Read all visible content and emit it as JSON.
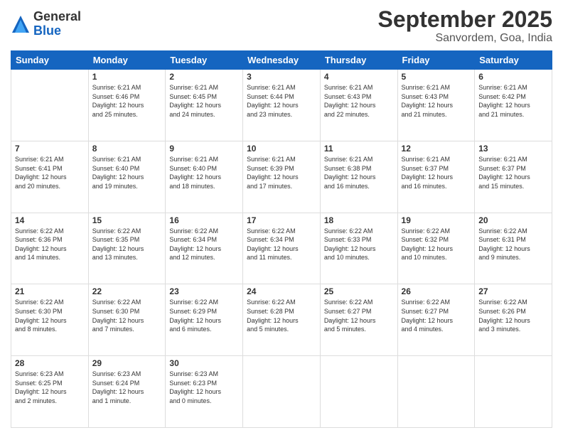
{
  "logo": {
    "general": "General",
    "blue": "Blue"
  },
  "title": "September 2025",
  "subtitle": "Sanvordem, Goa, India",
  "days_header": [
    "Sunday",
    "Monday",
    "Tuesday",
    "Wednesday",
    "Thursday",
    "Friday",
    "Saturday"
  ],
  "weeks": [
    [
      {
        "num": "",
        "info": ""
      },
      {
        "num": "1",
        "info": "Sunrise: 6:21 AM\nSunset: 6:46 PM\nDaylight: 12 hours\nand 25 minutes."
      },
      {
        "num": "2",
        "info": "Sunrise: 6:21 AM\nSunset: 6:45 PM\nDaylight: 12 hours\nand 24 minutes."
      },
      {
        "num": "3",
        "info": "Sunrise: 6:21 AM\nSunset: 6:44 PM\nDaylight: 12 hours\nand 23 minutes."
      },
      {
        "num": "4",
        "info": "Sunrise: 6:21 AM\nSunset: 6:43 PM\nDaylight: 12 hours\nand 22 minutes."
      },
      {
        "num": "5",
        "info": "Sunrise: 6:21 AM\nSunset: 6:43 PM\nDaylight: 12 hours\nand 21 minutes."
      },
      {
        "num": "6",
        "info": "Sunrise: 6:21 AM\nSunset: 6:42 PM\nDaylight: 12 hours\nand 21 minutes."
      }
    ],
    [
      {
        "num": "7",
        "info": "Sunrise: 6:21 AM\nSunset: 6:41 PM\nDaylight: 12 hours\nand 20 minutes."
      },
      {
        "num": "8",
        "info": "Sunrise: 6:21 AM\nSunset: 6:40 PM\nDaylight: 12 hours\nand 19 minutes."
      },
      {
        "num": "9",
        "info": "Sunrise: 6:21 AM\nSunset: 6:40 PM\nDaylight: 12 hours\nand 18 minutes."
      },
      {
        "num": "10",
        "info": "Sunrise: 6:21 AM\nSunset: 6:39 PM\nDaylight: 12 hours\nand 17 minutes."
      },
      {
        "num": "11",
        "info": "Sunrise: 6:21 AM\nSunset: 6:38 PM\nDaylight: 12 hours\nand 16 minutes."
      },
      {
        "num": "12",
        "info": "Sunrise: 6:21 AM\nSunset: 6:37 PM\nDaylight: 12 hours\nand 16 minutes."
      },
      {
        "num": "13",
        "info": "Sunrise: 6:21 AM\nSunset: 6:37 PM\nDaylight: 12 hours\nand 15 minutes."
      }
    ],
    [
      {
        "num": "14",
        "info": "Sunrise: 6:22 AM\nSunset: 6:36 PM\nDaylight: 12 hours\nand 14 minutes."
      },
      {
        "num": "15",
        "info": "Sunrise: 6:22 AM\nSunset: 6:35 PM\nDaylight: 12 hours\nand 13 minutes."
      },
      {
        "num": "16",
        "info": "Sunrise: 6:22 AM\nSunset: 6:34 PM\nDaylight: 12 hours\nand 12 minutes."
      },
      {
        "num": "17",
        "info": "Sunrise: 6:22 AM\nSunset: 6:34 PM\nDaylight: 12 hours\nand 11 minutes."
      },
      {
        "num": "18",
        "info": "Sunrise: 6:22 AM\nSunset: 6:33 PM\nDaylight: 12 hours\nand 10 minutes."
      },
      {
        "num": "19",
        "info": "Sunrise: 6:22 AM\nSunset: 6:32 PM\nDaylight: 12 hours\nand 10 minutes."
      },
      {
        "num": "20",
        "info": "Sunrise: 6:22 AM\nSunset: 6:31 PM\nDaylight: 12 hours\nand 9 minutes."
      }
    ],
    [
      {
        "num": "21",
        "info": "Sunrise: 6:22 AM\nSunset: 6:30 PM\nDaylight: 12 hours\nand 8 minutes."
      },
      {
        "num": "22",
        "info": "Sunrise: 6:22 AM\nSunset: 6:30 PM\nDaylight: 12 hours\nand 7 minutes."
      },
      {
        "num": "23",
        "info": "Sunrise: 6:22 AM\nSunset: 6:29 PM\nDaylight: 12 hours\nand 6 minutes."
      },
      {
        "num": "24",
        "info": "Sunrise: 6:22 AM\nSunset: 6:28 PM\nDaylight: 12 hours\nand 5 minutes."
      },
      {
        "num": "25",
        "info": "Sunrise: 6:22 AM\nSunset: 6:27 PM\nDaylight: 12 hours\nand 5 minutes."
      },
      {
        "num": "26",
        "info": "Sunrise: 6:22 AM\nSunset: 6:27 PM\nDaylight: 12 hours\nand 4 minutes."
      },
      {
        "num": "27",
        "info": "Sunrise: 6:22 AM\nSunset: 6:26 PM\nDaylight: 12 hours\nand 3 minutes."
      }
    ],
    [
      {
        "num": "28",
        "info": "Sunrise: 6:23 AM\nSunset: 6:25 PM\nDaylight: 12 hours\nand 2 minutes."
      },
      {
        "num": "29",
        "info": "Sunrise: 6:23 AM\nSunset: 6:24 PM\nDaylight: 12 hours\nand 1 minute."
      },
      {
        "num": "30",
        "info": "Sunrise: 6:23 AM\nSunset: 6:23 PM\nDaylight: 12 hours\nand 0 minutes."
      },
      {
        "num": "",
        "info": ""
      },
      {
        "num": "",
        "info": ""
      },
      {
        "num": "",
        "info": ""
      },
      {
        "num": "",
        "info": ""
      }
    ]
  ]
}
